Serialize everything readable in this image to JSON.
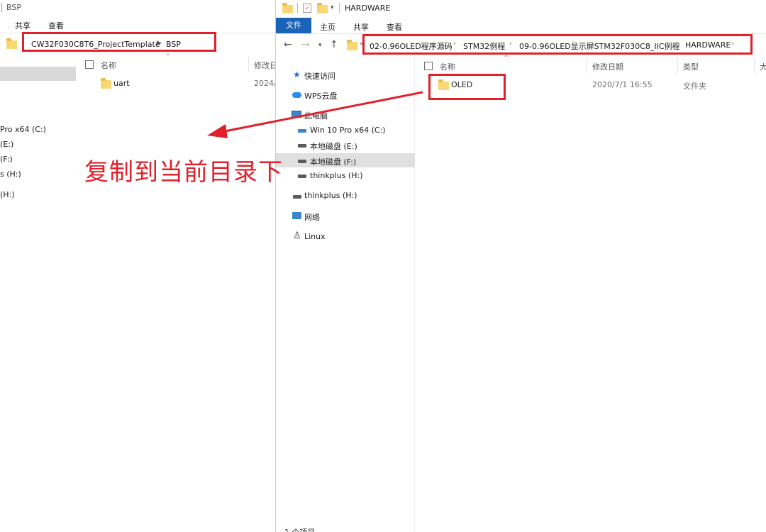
{
  "left_window": {
    "title": "BSP",
    "ribbon_tabs": [
      "共享",
      "查看"
    ],
    "address": {
      "segments": [
        "CW32F030C8T6_ProjectTemplate",
        "BSP"
      ]
    },
    "nav_items": [
      "Pro x64 (C:)",
      "(E:)",
      "(F:)",
      "s (H:)",
      "(H:)"
    ],
    "columns": {
      "name": "名称",
      "date": "修改日"
    },
    "files": [
      {
        "name": "uart",
        "date": "2024/"
      }
    ]
  },
  "right_window": {
    "title": "HARDWARE",
    "ribbon_tabs": [
      "文件",
      "主页",
      "共享",
      "查看"
    ],
    "address": {
      "segments": [
        "02-0.96OLED程序源码",
        "STM32例程",
        "09-0.96OLED显示屏STM32F030C8_IIC例程",
        "HARDWARE"
      ]
    },
    "nav_pane": {
      "quick_access": "快速访问",
      "wps_cloud": "WPS云盘",
      "this_pc": "此电脑",
      "drives": [
        "Win 10 Pro x64 (C:)",
        "本地磁盘 (E:)",
        "本地磁盘 (F:)",
        "thinkplus (H:)"
      ],
      "external": "thinkplus (H:)",
      "network": "网络",
      "linux": "Linux"
    },
    "columns": {
      "name": "名称",
      "date": "修改日期",
      "type": "类型",
      "size": "大"
    },
    "files": [
      {
        "name": "OLED",
        "date": "2020/7/1 16:55",
        "type": "文件夹"
      }
    ],
    "status": "1 个项目"
  },
  "annotation": {
    "text": "复制到当前目录下",
    "color": "#e0212b"
  },
  "colors": {
    "accent": "#1a63b8",
    "highlight_red": "#e0212b",
    "folder": "#f8d775"
  }
}
